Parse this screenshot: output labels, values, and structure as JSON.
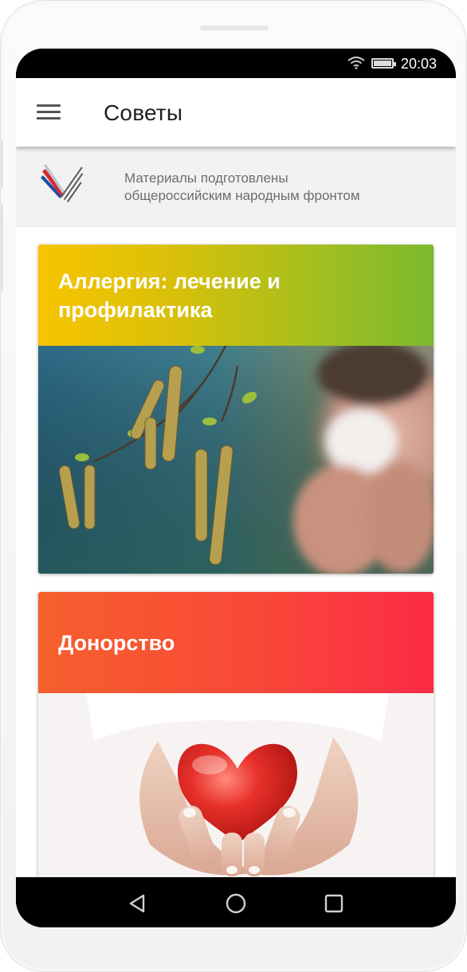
{
  "status_bar": {
    "time": "20:03",
    "icons": [
      "wifi-icon",
      "battery-icon"
    ]
  },
  "app_bar": {
    "menu_icon": "hamburger-menu-icon",
    "title": "Советы"
  },
  "banner": {
    "logo": "onf-logo",
    "text_line1": "Материалы подготовлены",
    "text_line2": "общероссийским народным фронтом"
  },
  "cards": [
    {
      "title_line1": "Аллергия: лечение и",
      "title_line2": "профилактика",
      "gradient_start": "#f8c400",
      "gradient_end": "#7cb82f",
      "image": "birch-catkins-allergy-photo"
    },
    {
      "title": "Донорство",
      "gradient_start": "#f6602d",
      "gradient_end": "#fb2b46",
      "image": "hands-holding-heart-photo"
    }
  ],
  "nav_bar": {
    "icons": [
      "back-icon",
      "home-icon",
      "recent-apps-icon"
    ]
  },
  "colors": {
    "status_bar": "#000000",
    "app_bar": "#ffffff",
    "banner_bg": "#f2f2f2",
    "banner_text": "#6d6d6d"
  }
}
